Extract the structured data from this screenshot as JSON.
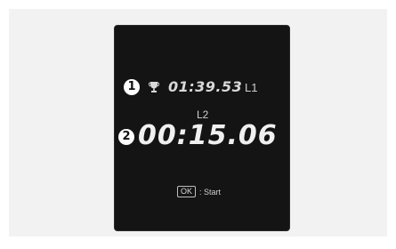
{
  "screen": {
    "best_lap": {
      "marker": "1",
      "icon": "trophy-icon",
      "time": "01:39.53",
      "lap_label": "L1"
    },
    "current_lap": {
      "marker": "2",
      "lap_label": "L2",
      "time": "00:15.06"
    },
    "hint": {
      "key_label": "OK",
      "action_text": ": Start"
    }
  },
  "colors": {
    "screen_background": "#141414",
    "panel_background": "#f2f2f2",
    "text": "#e6e6e6"
  }
}
